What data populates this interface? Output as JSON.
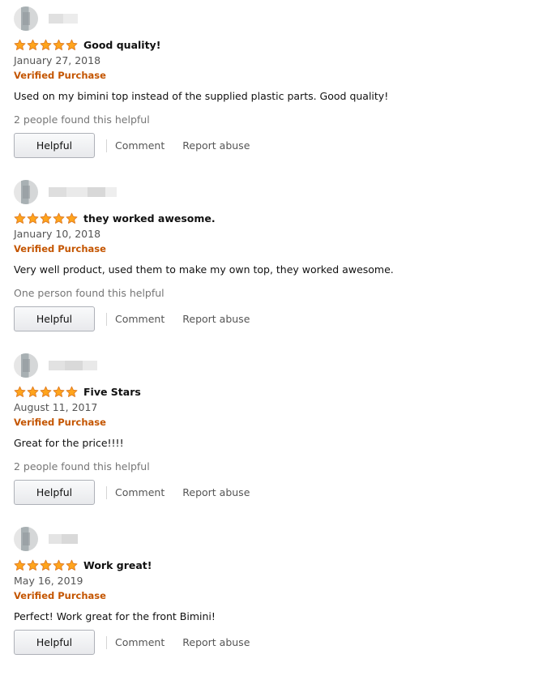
{
  "colors": {
    "star_fill": "#ffa41c",
    "star_stroke": "#de7921",
    "verified": "#c45500",
    "muted_text": "#767676",
    "link_text": "#555555"
  },
  "actions": {
    "helpful_label": "Helpful",
    "comment_label": "Comment",
    "report_label": "Report abuse"
  },
  "reviews": [
    {
      "rating": 5,
      "title": "Good quality!",
      "date": "January 27, 2018",
      "verified": "Verified Purchase",
      "body": "Used on my bimini top instead of the supplied plastic parts. Good quality!",
      "helpful_count": "2 people found this helpful"
    },
    {
      "rating": 5,
      "title": "they worked awesome.",
      "date": "January 10, 2018",
      "verified": "Verified Purchase",
      "body": "Very well product, used them to make my own top, they worked awesome.",
      "helpful_count": "One person found this helpful"
    },
    {
      "rating": 5,
      "title": "Five Stars",
      "date": "August 11, 2017",
      "verified": "Verified Purchase",
      "body": "Great for the price!!!!",
      "helpful_count": "2 people found this helpful"
    },
    {
      "rating": 5,
      "title": "Work great!",
      "date": "May 16, 2019",
      "verified": "Verified Purchase",
      "body": "Perfect! Work great for the front Bimini!",
      "helpful_count": ""
    }
  ]
}
